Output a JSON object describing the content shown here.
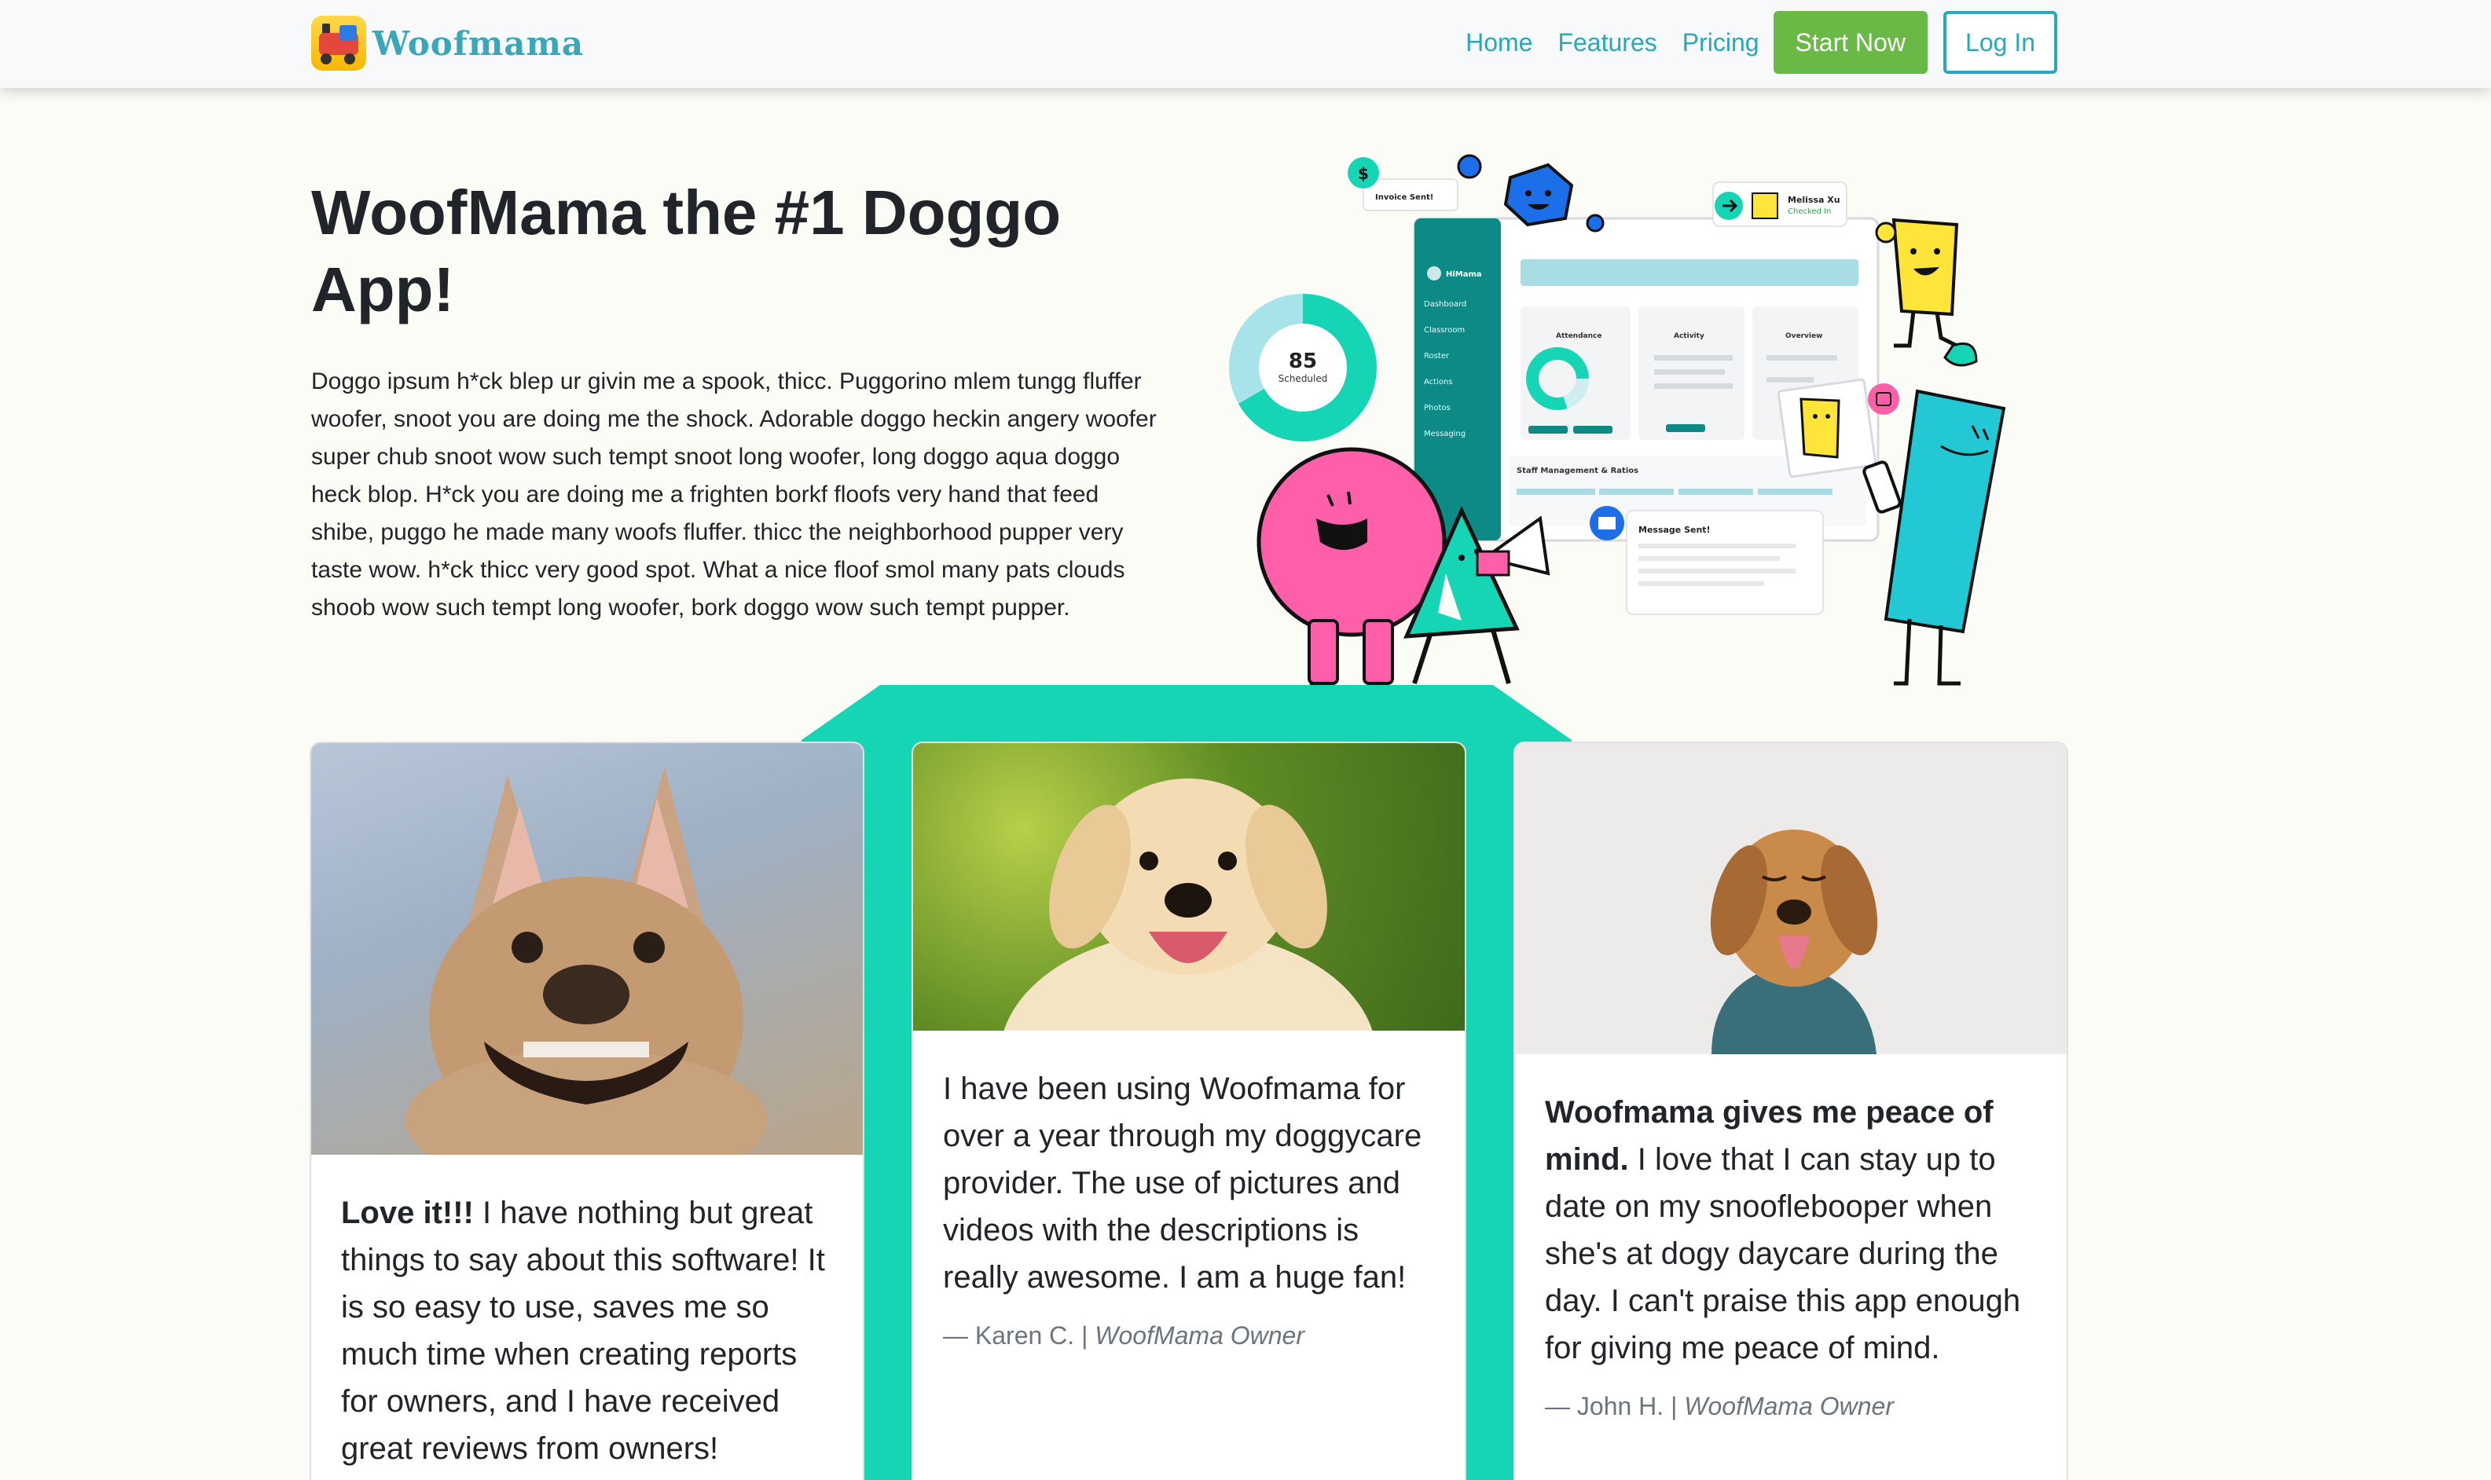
{
  "nav": {
    "brand": "Woofmama",
    "links": [
      "Home",
      "Features",
      "Pricing"
    ],
    "start_label": "Start Now",
    "login_label": "Log In"
  },
  "hero": {
    "title": "WoofMama the #1 Doggo App!",
    "text": "Doggo ipsum h*ck blep ur givin me a spook, thicc. Puggorino mlem tungg fluffer woofer, snoot you are doing me the shock. Adorable doggo heckin angery woofer super chub snoot wow such tempt snoot long woofer, long doggo aqua doggo heck blop. H*ck you are doing me a frighten borkf floofs very hand that feed shibe, puggo he made many woofs fluffer. thicc the neighborhood pupper very taste wow. h*ck thicc very good spot. What a nice floof smol many pats clouds shoob wow such tempt long woofer, bork doggo wow such tempt pupper."
  },
  "illustration": {
    "invoice_label": "Invoice Sent!",
    "checkin_name": "Melissa Xu",
    "checkin_status": "Checked In",
    "scheduled_count": "85",
    "scheduled_label": "Scheduled",
    "app_name": "HiMama",
    "sidebar_items": [
      "Dashboard",
      "Classroom",
      "Roster",
      "Actions",
      "Photos",
      "Messaging"
    ],
    "panels": [
      "Attendance",
      "Activity",
      "Overview"
    ],
    "staff_label": "Staff Management & Ratios",
    "message_label": "Message Sent!",
    "colors": {
      "pink": "#ff5fa8",
      "teal": "#16d5b4",
      "yellow": "#ffe53a",
      "blue": "#1c6fe8",
      "cyan": "#22c8d4"
    }
  },
  "testimonials": [
    {
      "image": "french-bulldog-photo",
      "bold": "Love it!!!",
      "text": " I have nothing but great things to say about this software! It is so easy to use, saves me so much time when creating reports for owners, and I have received great reviews from owners!",
      "author": "",
      "role": ""
    },
    {
      "image": "lab-puppy-photo",
      "bold": "",
      "text": "I have been using Woofmama for over a year through my doggycare provider. The use of pictures and videos with the descriptions is really awesome. I am a huge fan!",
      "author": "— Karen C. | ",
      "role": "WoofMama Owner"
    },
    {
      "image": "golden-retriever-photo",
      "bold": "Woofmama gives me peace of mind.",
      "text": " I love that I can stay up to date on my snooflebooper when she's at dogy daycare during the day. I can't praise this app enough for giving me peace of mind.",
      "author": "— John H. | ",
      "role": "WoofMama Owner"
    }
  ]
}
